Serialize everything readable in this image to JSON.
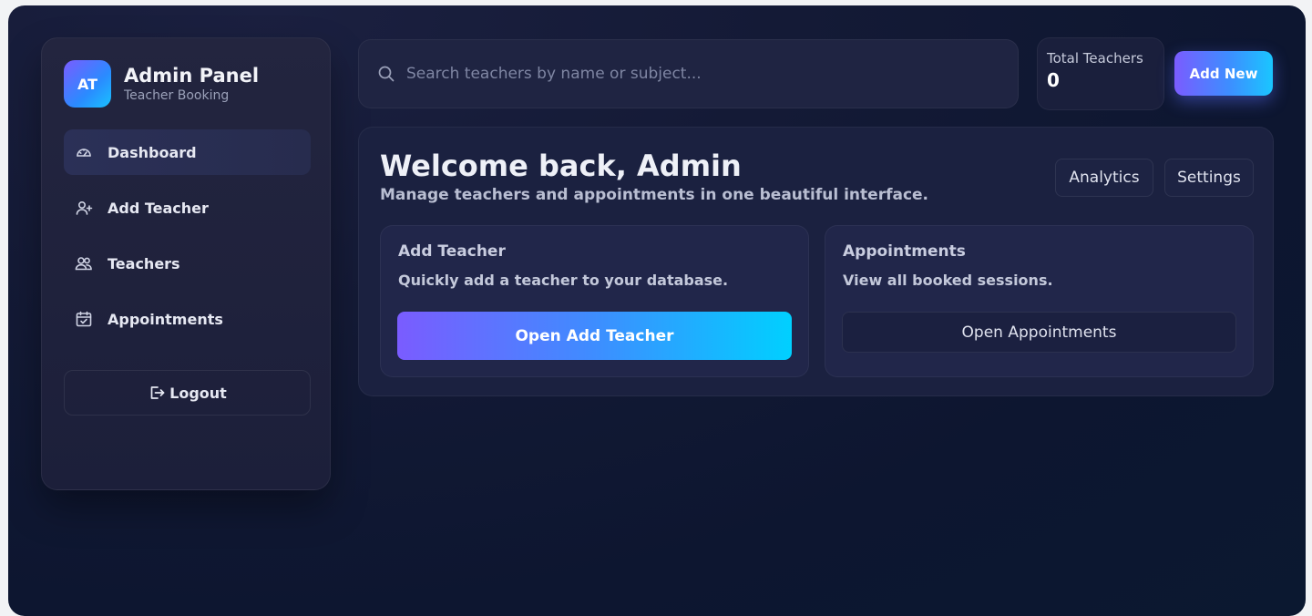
{
  "sidebar": {
    "avatar_initials": "AT",
    "brand_title": "Admin Panel",
    "brand_subtitle": "Teacher Booking",
    "items": [
      {
        "label": "Dashboard",
        "icon": "gauge-icon",
        "active": true
      },
      {
        "label": "Add Teacher",
        "icon": "user-plus-icon",
        "active": false
      },
      {
        "label": "Teachers",
        "icon": "users-icon",
        "active": false
      },
      {
        "label": "Appointments",
        "icon": "calendar-check-icon",
        "active": false
      }
    ],
    "logout_label": "Logout"
  },
  "search": {
    "placeholder": "Search teachers by name or subject..."
  },
  "stats": {
    "total_teachers_label": "Total Teachers",
    "total_teachers_value": "0"
  },
  "header": {
    "add_new_label": "Add New"
  },
  "main": {
    "welcome_title": "Welcome back, Admin",
    "welcome_subtitle": "Manage teachers and appointments in one beautiful interface.",
    "analytics_label": "Analytics",
    "settings_label": "Settings",
    "cards": [
      {
        "title": "Add Teacher",
        "description": "Quickly add a teacher to your database.",
        "button_label": "Open Add Teacher"
      },
      {
        "title": "Appointments",
        "description": "View all booked sessions.",
        "button_label": "Open Appointments"
      }
    ]
  },
  "colors": {
    "accent_start": "#7a5cff",
    "accent_end": "#00d0ff",
    "background": "#141a36"
  }
}
